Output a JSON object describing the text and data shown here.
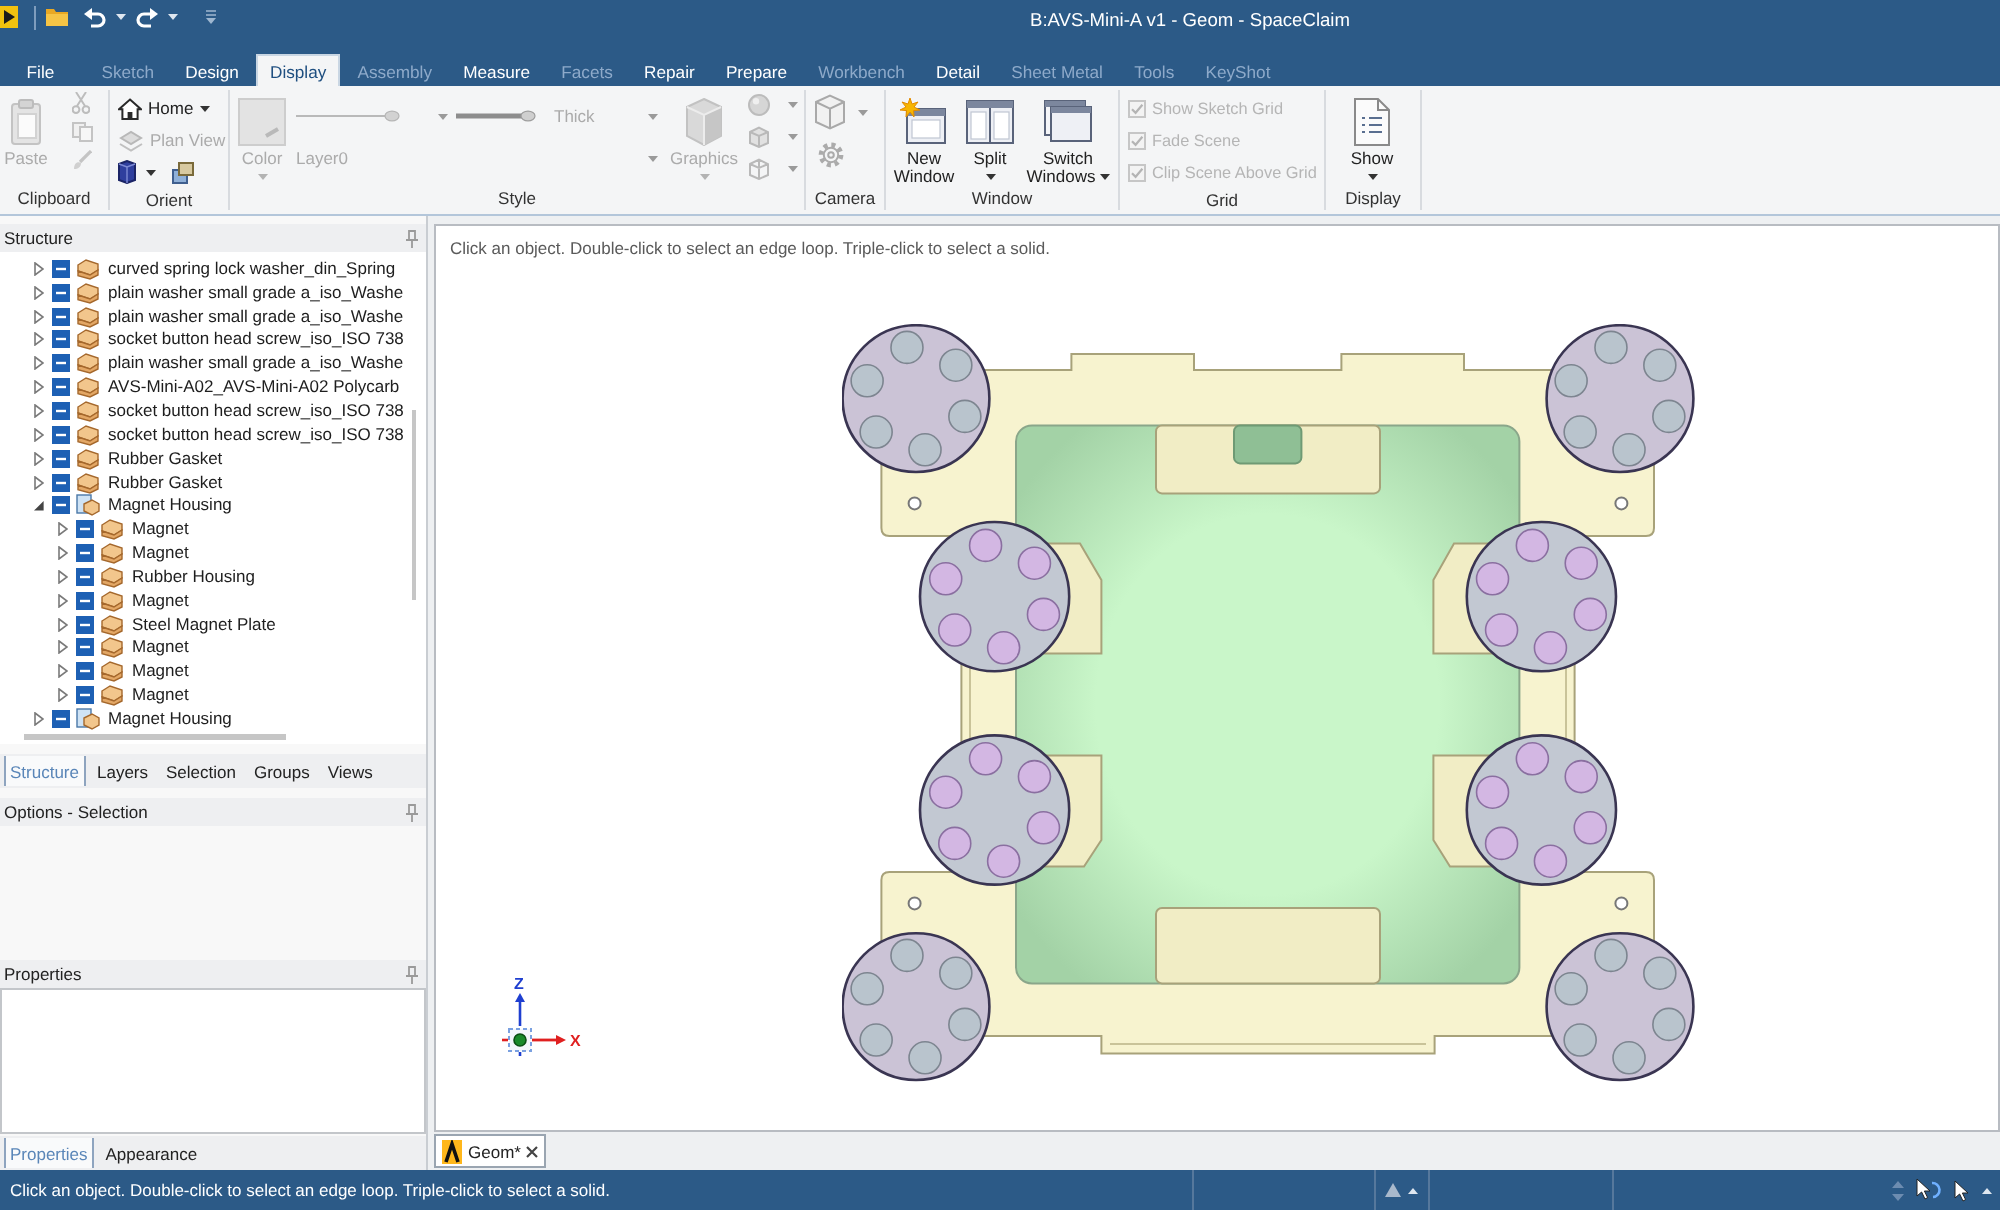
{
  "window": {
    "title": "B:AVS-Mini-A v1 - Geom - SpaceClaim"
  },
  "ribbon_tabs": [
    {
      "label": "File",
      "selected": false,
      "disabled": false
    },
    {
      "label": "Sketch",
      "selected": false,
      "disabled": true
    },
    {
      "label": "Design",
      "selected": false,
      "disabled": false
    },
    {
      "label": "Display",
      "selected": true,
      "disabled": false
    },
    {
      "label": "Assembly",
      "selected": false,
      "disabled": true
    },
    {
      "label": "Measure",
      "selected": false,
      "disabled": false
    },
    {
      "label": "Facets",
      "selected": false,
      "disabled": true
    },
    {
      "label": "Repair",
      "selected": false,
      "disabled": false
    },
    {
      "label": "Prepare",
      "selected": false,
      "disabled": false
    },
    {
      "label": "Workbench",
      "selected": false,
      "disabled": true
    },
    {
      "label": "Detail",
      "selected": false,
      "disabled": false
    },
    {
      "label": "Sheet Metal",
      "selected": false,
      "disabled": true
    },
    {
      "label": "Tools",
      "selected": false,
      "disabled": true
    },
    {
      "label": "KeyShot",
      "selected": false,
      "disabled": true
    }
  ],
  "ribbon": {
    "clipboard": {
      "label": "Clipboard",
      "paste": {
        "label": "Paste",
        "disabled": true
      }
    },
    "orient": {
      "label": "Orient",
      "home": {
        "label": "Home",
        "disabled": false,
        "menu": true
      },
      "plan_view": {
        "label": "Plan View",
        "disabled": true
      }
    },
    "style": {
      "label": "Style",
      "color": {
        "label": "Color",
        "disabled": true,
        "menu": true,
        "menu_inline": false
      },
      "line_weight": {
        "value": "Thick",
        "disabled": true
      },
      "layer": {
        "value": "Layer0",
        "disabled": true
      },
      "graphics": {
        "label": "Graphics",
        "disabled": true,
        "menu": true,
        "menu_inline": false
      }
    },
    "camera": {
      "label": "Camera"
    },
    "window": {
      "label": "Window",
      "buttons": [
        {
          "label": "New Window",
          "disabled": false,
          "menu": false
        },
        {
          "label": "Split",
          "disabled": false,
          "menu": true,
          "menu_inline": false
        },
        {
          "label": "Switch Windows",
          "disabled": false,
          "menu": true,
          "menu_inline": true
        }
      ]
    },
    "grid": {
      "label": "Grid",
      "options": [
        {
          "label": "Show Sketch Grid",
          "checked": true,
          "disabled": true
        },
        {
          "label": "Fade Scene",
          "checked": true,
          "disabled": true
        },
        {
          "label": "Clip Scene Above Grid",
          "checked": true,
          "disabled": true
        }
      ]
    },
    "display": {
      "label": "Display",
      "show": {
        "label": "Show",
        "disabled": false,
        "menu": true,
        "menu_inline": false
      }
    }
  },
  "structure": {
    "title": "Structure",
    "tree": [
      {
        "label": "curved spring lock washer_din_Spring",
        "kind": "component",
        "checked": true,
        "expanded": false
      },
      {
        "label": "plain washer small grade a_iso_Washe",
        "kind": "component",
        "checked": true,
        "expanded": false
      },
      {
        "label": "plain washer small grade a_iso_Washe",
        "kind": "component",
        "checked": true,
        "expanded": false
      },
      {
        "label": "socket button head screw_iso_ISO 738",
        "kind": "component",
        "checked": true,
        "expanded": false
      },
      {
        "label": "plain washer small grade a_iso_Washe",
        "kind": "component",
        "checked": true,
        "expanded": false
      },
      {
        "label": "AVS-Mini-A02_AVS-Mini-A02 Polycarb",
        "kind": "component",
        "checked": true,
        "expanded": false
      },
      {
        "label": "socket button head screw_iso_ISO 738",
        "kind": "component",
        "checked": true,
        "expanded": false
      },
      {
        "label": "socket button head screw_iso_ISO 738",
        "kind": "component",
        "checked": true,
        "expanded": false
      },
      {
        "label": "Rubber Gasket",
        "kind": "component",
        "checked": true,
        "expanded": false
      },
      {
        "label": "Rubber Gasket",
        "kind": "component",
        "checked": true,
        "expanded": false
      },
      {
        "label": "Magnet Housing",
        "kind": "assembly",
        "checked": true,
        "expanded": true,
        "children": [
          {
            "label": "Magnet",
            "kind": "component",
            "checked": true,
            "expanded": false
          },
          {
            "label": "Magnet",
            "kind": "component",
            "checked": true,
            "expanded": false
          },
          {
            "label": "Rubber Housing",
            "kind": "component",
            "checked": true,
            "expanded": false
          },
          {
            "label": "Magnet",
            "kind": "component",
            "checked": true,
            "expanded": false
          },
          {
            "label": "Steel Magnet Plate",
            "kind": "component",
            "checked": true,
            "expanded": false
          },
          {
            "label": "Magnet",
            "kind": "component",
            "checked": true,
            "expanded": false
          },
          {
            "label": "Magnet",
            "kind": "component",
            "checked": true,
            "expanded": false
          },
          {
            "label": "Magnet",
            "kind": "component",
            "checked": true,
            "expanded": false
          }
        ]
      },
      {
        "label": "Magnet Housing",
        "kind": "assembly",
        "checked": true,
        "expanded": false
      }
    ]
  },
  "panel_tabs": [
    {
      "label": "Structure",
      "selected": true
    },
    {
      "label": "Layers",
      "selected": false
    },
    {
      "label": "Selection",
      "selected": false
    },
    {
      "label": "Groups",
      "selected": false
    },
    {
      "label": "Views",
      "selected": false
    }
  ],
  "options": {
    "title": "Options - Selection"
  },
  "properties": {
    "title": "Properties"
  },
  "properties_tabs": [
    {
      "label": "Properties",
      "selected": true
    },
    {
      "label": "Appearance",
      "selected": false
    }
  ],
  "viewport": {
    "hint": "Click an object. Double-click to select an edge loop. Triple-click to select a solid.",
    "axes": {
      "z_label": "Z",
      "x_label": "X"
    }
  },
  "document_tabs": [
    {
      "label": "Geom*",
      "selected": true
    }
  ],
  "status_bar": {
    "message": "Click an object. Double-click to select an edge loop. Triple-click to select a solid."
  }
}
